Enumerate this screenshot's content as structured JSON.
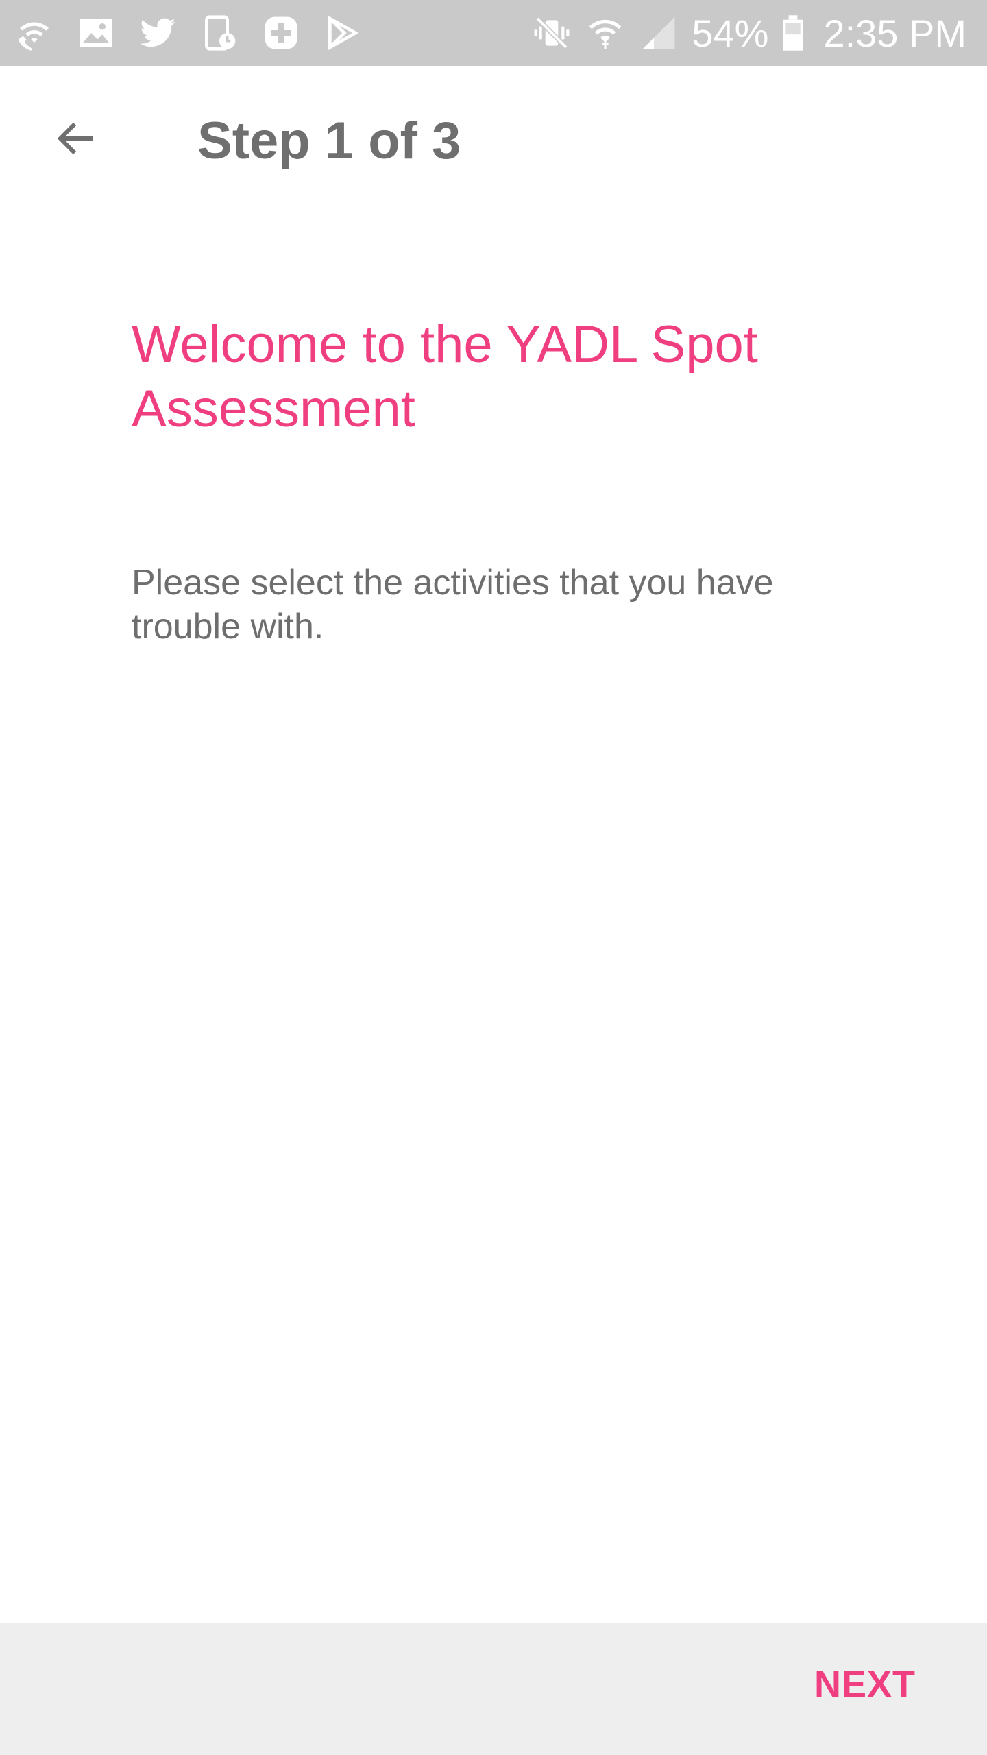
{
  "status_bar": {
    "left_icons": [
      "wifi-call-icon",
      "image-icon",
      "twitter-icon",
      "clock-sim-icon",
      "plus-circle-icon",
      "play-store-icon"
    ],
    "right_icons": [
      "mute-vibrate-icon",
      "wifi-icon",
      "signal-icon",
      "battery-icon"
    ],
    "battery": "54%",
    "time": "2:35 PM"
  },
  "app_bar": {
    "back_icon": "arrow-back-icon",
    "title": "Step 1 of 3"
  },
  "content": {
    "title": "Welcome to the YADL Spot Assessment",
    "instructions": "Please select the activities that you have trouble with."
  },
  "footer": {
    "next_label": "NEXT"
  },
  "colors": {
    "accent": "#ef3f80",
    "status_bar": "#c9c9c9",
    "text_gray": "#6f6f6f",
    "footer_bg": "#eeeeee"
  }
}
